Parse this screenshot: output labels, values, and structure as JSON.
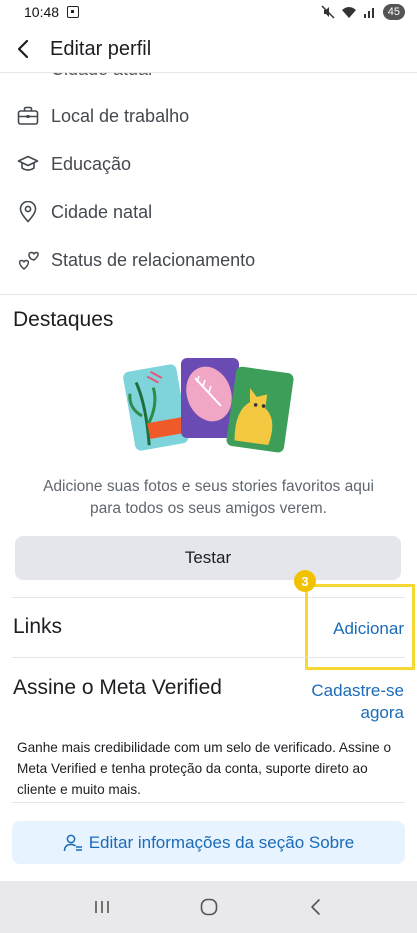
{
  "status_bar": {
    "time": "10:48",
    "battery": "45"
  },
  "header": {
    "title": "Editar perfil"
  },
  "about": {
    "clipped_item": "Cidade atual",
    "items": [
      {
        "label": "Local de trabalho",
        "icon": "briefcase-icon"
      },
      {
        "label": "Educação",
        "icon": "graduation-cap-icon"
      },
      {
        "label": "Cidade natal",
        "icon": "location-pin-icon"
      },
      {
        "label": "Status de relacionamento",
        "icon": "hearts-icon"
      }
    ]
  },
  "highlights": {
    "title": "Destaques",
    "description_line1": "Adicione suas fotos e seus stories favoritos aqui",
    "description_line2": "para todos os seus amigos verem.",
    "button_label": "Testar"
  },
  "links": {
    "title": "Links",
    "action": "Adicionar",
    "badge": "3"
  },
  "meta_verified": {
    "title": "Assine o Meta Verified",
    "action_line1": "Cadastre-se",
    "action_line2": "agora",
    "description": "Ganhe mais credibilidade com um selo de verificado. Assine o Meta Verified e tenha proteção da conta, suporte direto ao cliente e muito mais."
  },
  "edit_about": {
    "label": "Editar informações da seção Sobre"
  },
  "colors": {
    "accent": "#1b6bb8",
    "highlight": "#f7d733"
  }
}
